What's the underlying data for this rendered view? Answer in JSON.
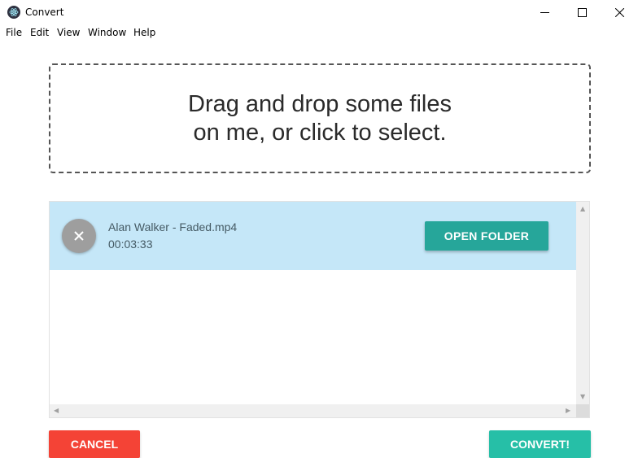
{
  "window": {
    "title": "Convert",
    "minimize_icon": "minimize-icon",
    "maximize_icon": "maximize-icon",
    "close_icon": "close-icon"
  },
  "menu": [
    "File",
    "Edit",
    "View",
    "Window",
    "Help"
  ],
  "dropzone": {
    "text": "Drag and drop some files on me, or click to select."
  },
  "files": [
    {
      "name": "Alan Walker - Faded.mp4",
      "duration": "00:03:33",
      "open_folder_label": "OPEN FOLDER",
      "remove_icon": "close-icon"
    }
  ],
  "actions": {
    "cancel_label": "CANCEL",
    "convert_label": "CONVERT!"
  },
  "colors": {
    "row_highlight": "#c5e7f8",
    "primary": "#26a69a",
    "convert": "#26bfa7",
    "cancel": "#f44336",
    "remove_button": "#9e9e9e"
  }
}
